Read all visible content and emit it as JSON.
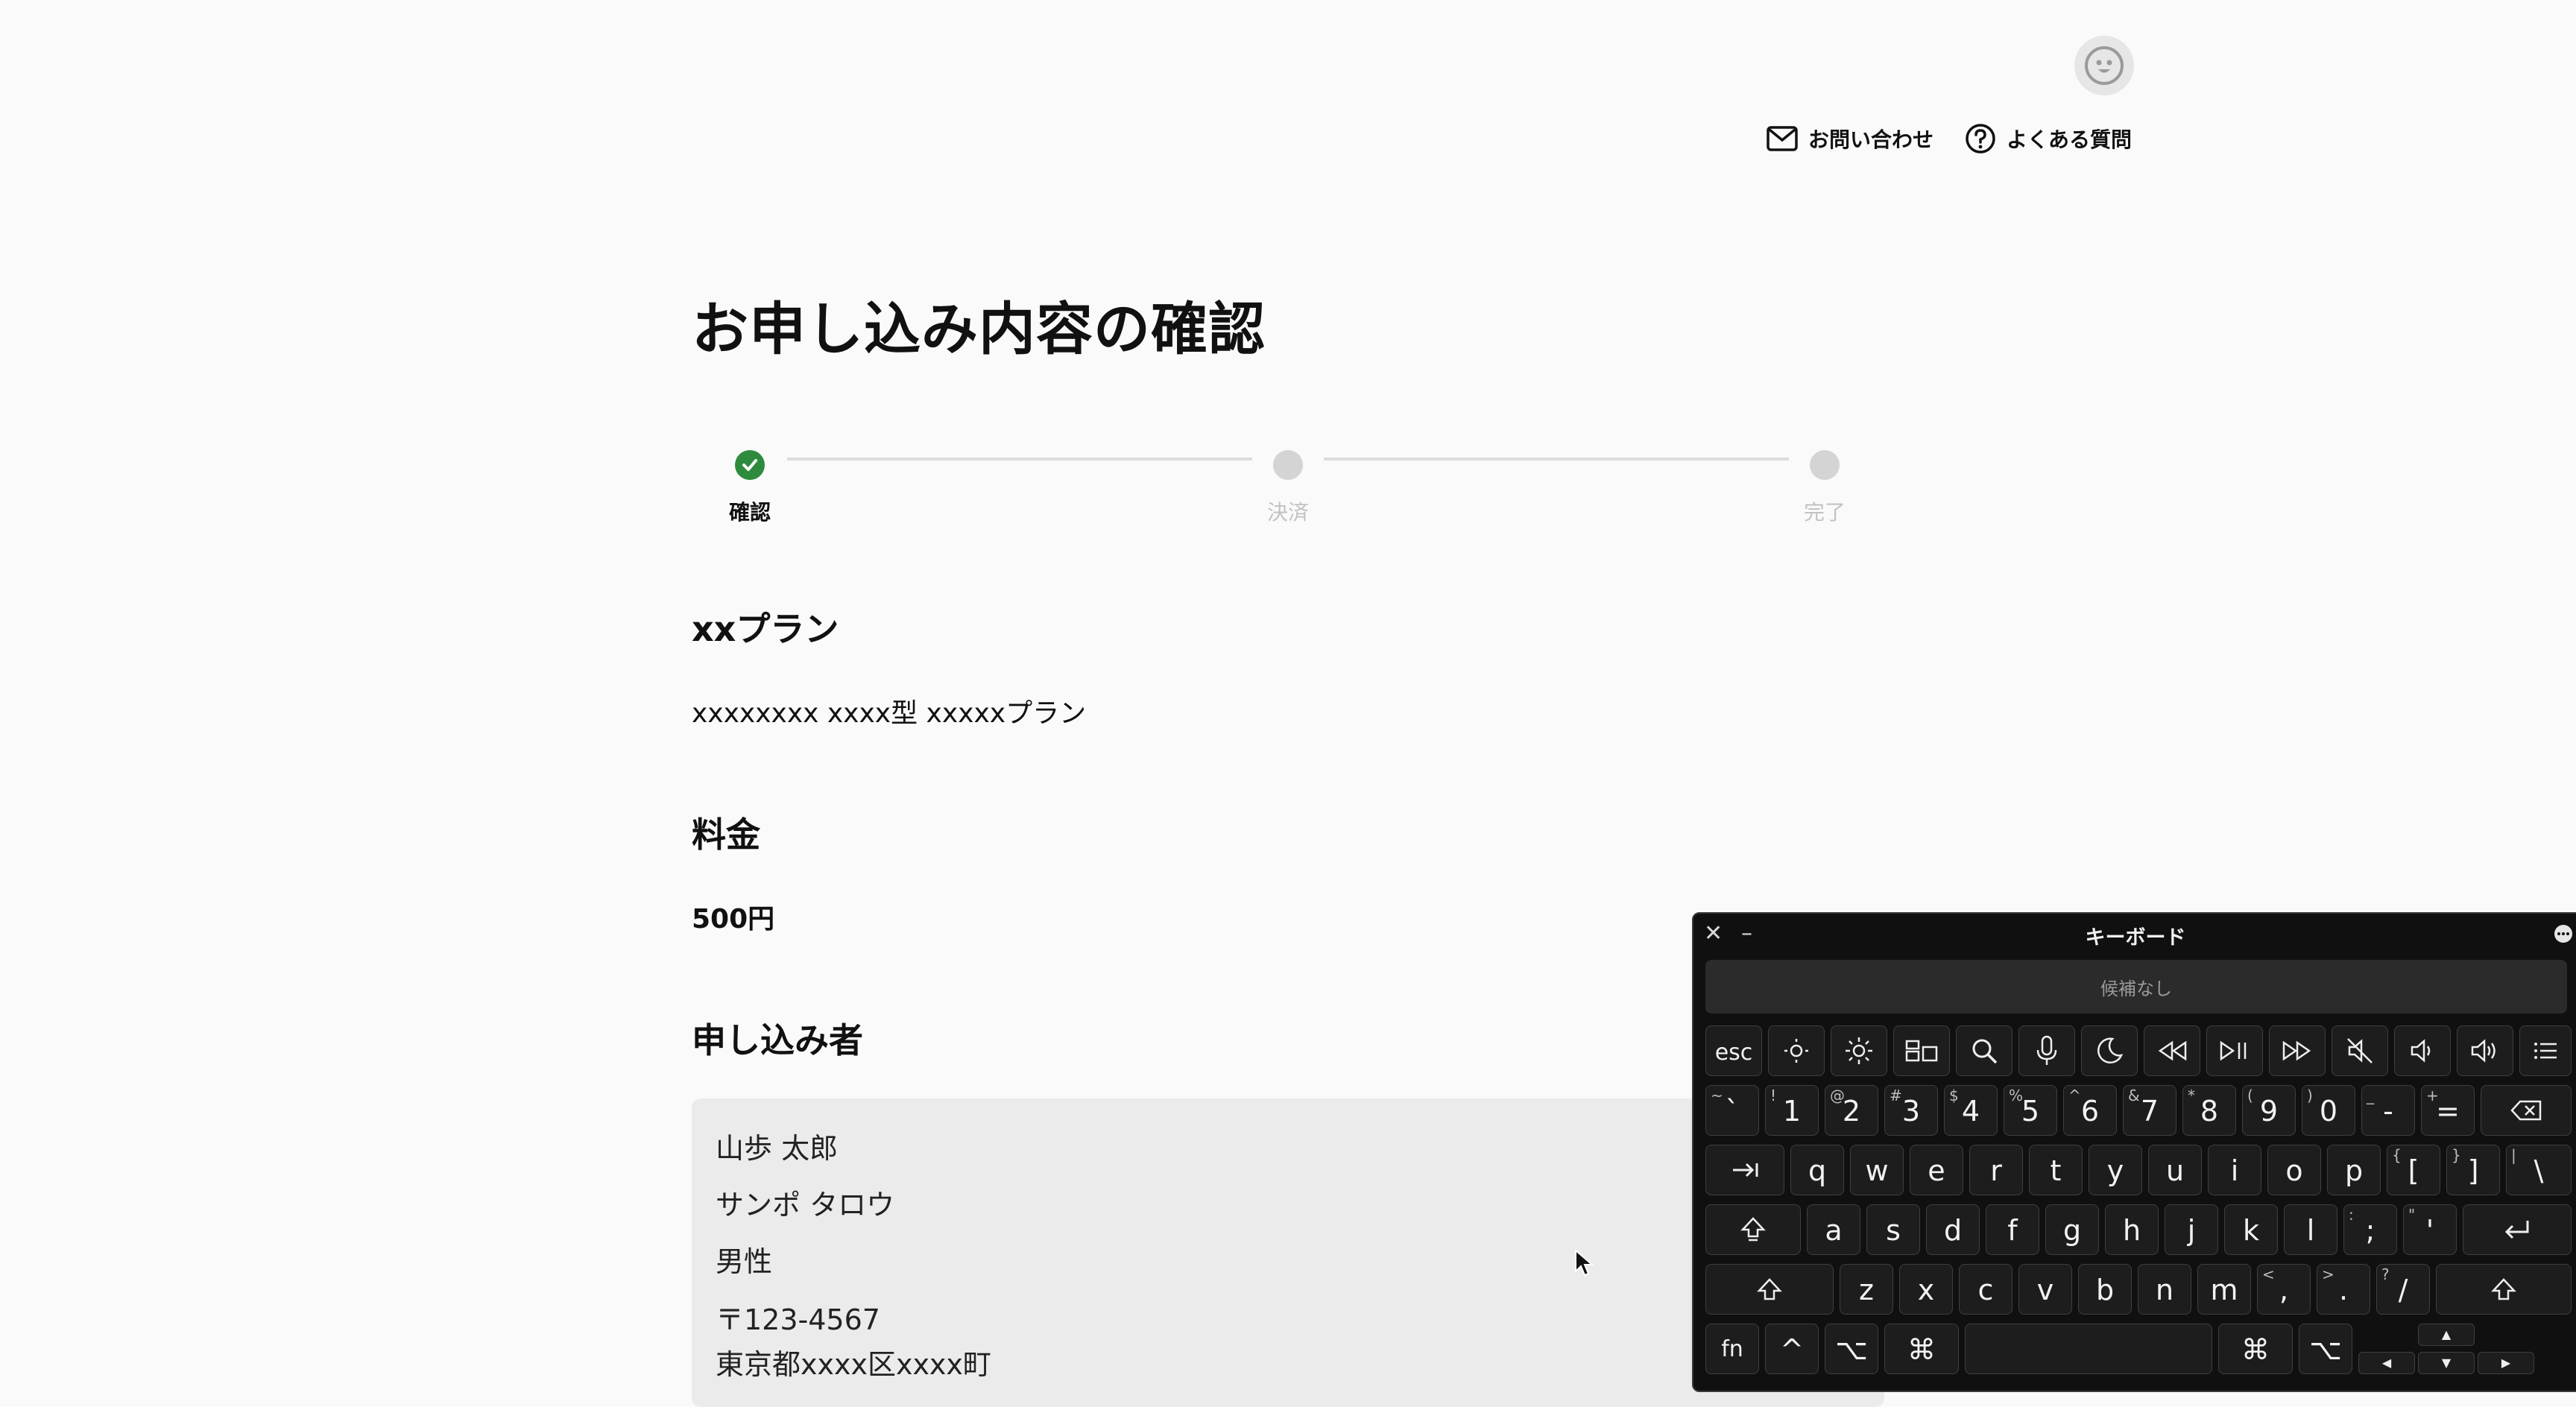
{
  "header": {
    "contact_label": "お問い合わせ",
    "faq_label": "よくある質問"
  },
  "page_title": "お申し込み内容の確認",
  "steps": [
    {
      "label": "確認",
      "state": "done"
    },
    {
      "label": "決済",
      "state": "pending"
    },
    {
      "label": "完了",
      "state": "pending"
    }
  ],
  "sections": {
    "plan": {
      "heading": "xxプラン",
      "value": "xxxxxxxx xxxx型 xxxxxプラン"
    },
    "price": {
      "heading": "料金",
      "value": "500円"
    },
    "applicant": {
      "heading": "申し込み者",
      "lines": [
        "山歩 太郎",
        "サンポ タロウ",
        "男性",
        "〒123-4567",
        "東京都xxxx区xxxx町"
      ]
    }
  },
  "colors": {
    "step_done": "#2e8b3e",
    "step_pending": "#d4d4d4",
    "background": "#fafafa"
  },
  "keyboard": {
    "title": "キーボード",
    "candidates": "候補なし",
    "fn_row": [
      "esc",
      "brightness-down-icon",
      "brightness-up-icon",
      "mission-control-icon",
      "spotlight-icon",
      "dictation-icon",
      "do-not-disturb-icon",
      "rewind-icon",
      "play-pause-icon",
      "fast-forward-icon",
      "mute-icon",
      "volume-down-icon",
      "volume-up-icon",
      "menu-icon"
    ],
    "number_row": [
      {
        "main": "`",
        "sub": "~"
      },
      {
        "main": "1",
        "sub": "!"
      },
      {
        "main": "2",
        "sub": "@"
      },
      {
        "main": "3",
        "sub": "#"
      },
      {
        "main": "4",
        "sub": "$"
      },
      {
        "main": "5",
        "sub": "%"
      },
      {
        "main": "6",
        "sub": "^"
      },
      {
        "main": "7",
        "sub": "&"
      },
      {
        "main": "8",
        "sub": "*"
      },
      {
        "main": "9",
        "sub": "("
      },
      {
        "main": "0",
        "sub": ")"
      },
      {
        "main": "-",
        "sub": "_"
      },
      {
        "main": "=",
        "sub": "+"
      }
    ],
    "row_q": [
      "q",
      "w",
      "e",
      "r",
      "t",
      "y",
      "u",
      "i",
      "o",
      "p"
    ],
    "row_q_extra": [
      {
        "main": "[",
        "sub": "{"
      },
      {
        "main": "]",
        "sub": "}"
      },
      {
        "main": "\\",
        "sub": "|"
      }
    ],
    "row_a": [
      "a",
      "s",
      "d",
      "f",
      "g",
      "h",
      "j",
      "k",
      "l"
    ],
    "row_a_extra": [
      {
        "main": ";",
        "sub": ":"
      },
      {
        "main": "'",
        "sub": "\""
      }
    ],
    "row_z": [
      "z",
      "x",
      "c",
      "v",
      "b",
      "n",
      "m"
    ],
    "row_z_extra": [
      {
        "main": ",",
        "sub": "<"
      },
      {
        "main": ".",
        "sub": ">"
      },
      {
        "main": "/",
        "sub": "?"
      }
    ],
    "bottom": {
      "fn": "fn",
      "control": "^",
      "option": "⌥",
      "command": "⌘"
    },
    "arrows": {
      "up": "▲",
      "left": "◀",
      "down": "▼",
      "right": "▶"
    }
  }
}
